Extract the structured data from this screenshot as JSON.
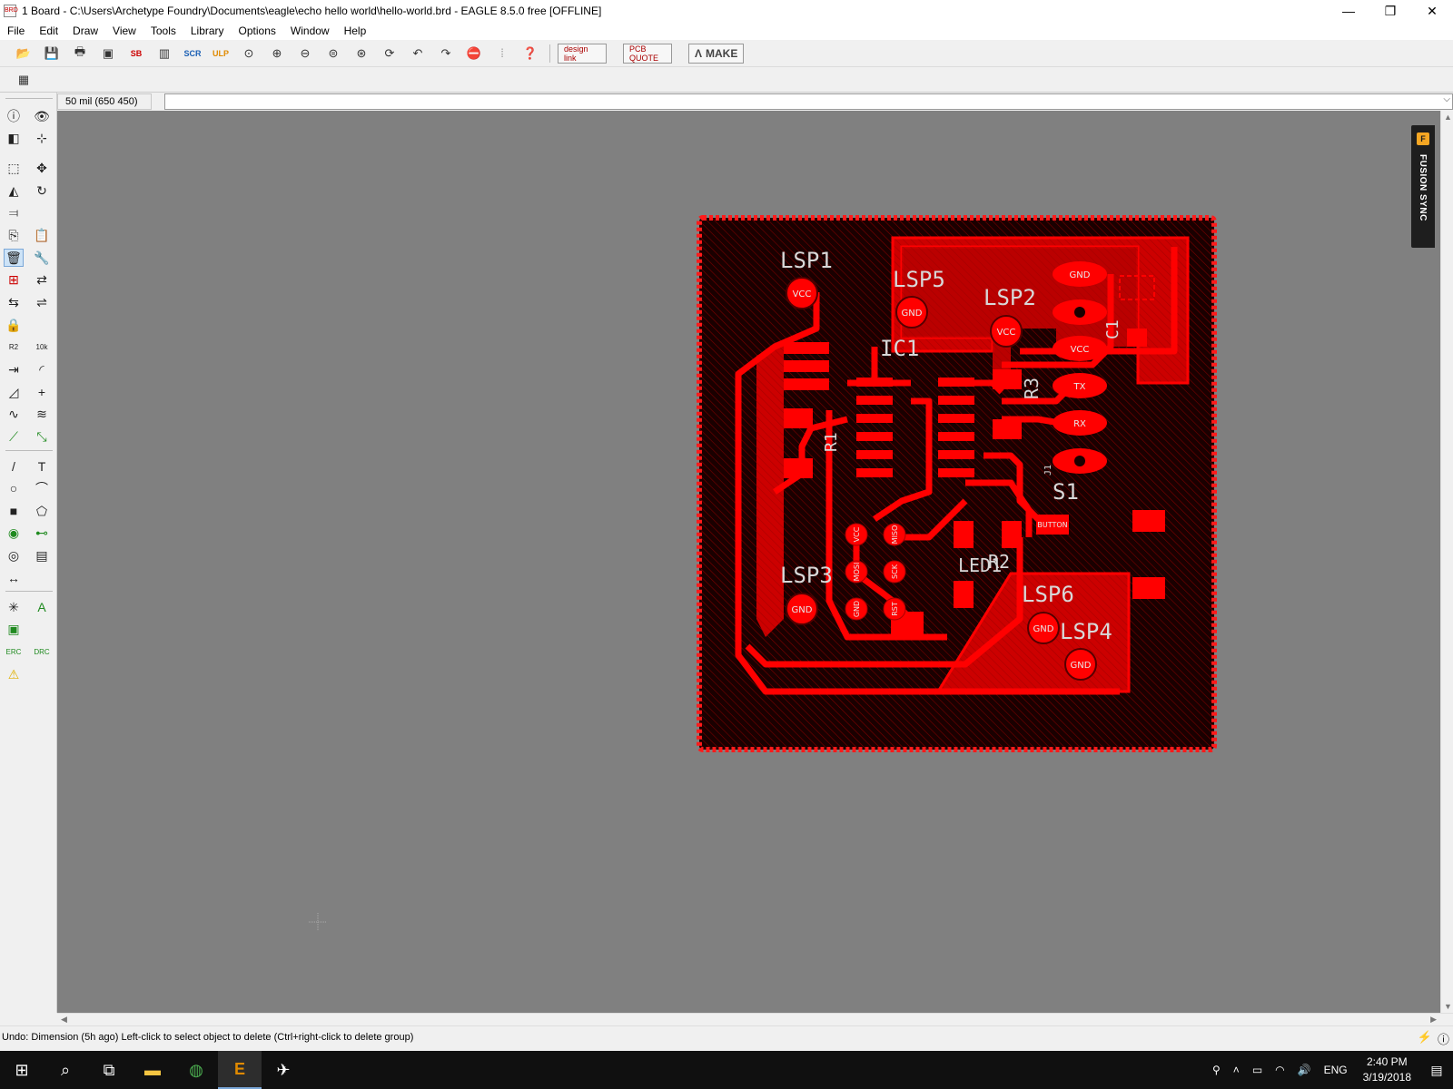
{
  "window": {
    "title": "1 Board - C:\\Users\\Archetype Foundry\\Documents\\eagle\\echo hello world\\hello-world.brd - EAGLE 8.5.0 free [OFFLINE]",
    "app_icon": "BRD",
    "minimize": "—",
    "maximize": "❐",
    "close": "✕"
  },
  "menu": [
    "File",
    "Edit",
    "Draw",
    "View",
    "Tools",
    "Library",
    "Options",
    "Window",
    "Help"
  ],
  "toolbar": {
    "design_link": "design link",
    "pcb_quote": "PCB QUOTE",
    "make": "MAKE"
  },
  "command": {
    "coordinates": "50 mil (650 450)",
    "input_value": ""
  },
  "fusion_sync": {
    "label": "FUSION SYNC",
    "icon": "F"
  },
  "board": {
    "outline_color": "#ff0000",
    "fill_color": "#cc0000",
    "background_color": "#1a0000",
    "labels": {
      "lsp1": "LSP1",
      "lsp2": "LSP2",
      "lsp3": "LSP3",
      "lsp4": "LSP4",
      "lsp5": "LSP5",
      "lsp6": "LSP6",
      "ic1": "IC1",
      "r1": "R1",
      "r2": "R2",
      "r3": "R3",
      "c1": "C1",
      "s1": "S1",
      "led1": "LED1",
      "j1": "J1"
    },
    "pads": {
      "vcc": "VCC",
      "gnd": "GND",
      "tx": "TX",
      "rx": "RX",
      "miso": "MISO",
      "mosi": "MOSI",
      "sck": "SCK",
      "rst": "RST",
      "button": "BUTTON"
    }
  },
  "status": {
    "text": "Undo: Dimension (5h ago) Left-click to select object to delete (Ctrl+right-click to delete group)"
  },
  "taskbar": {
    "language": "ENG",
    "time": "2:40 PM",
    "date": "3/19/2018"
  }
}
